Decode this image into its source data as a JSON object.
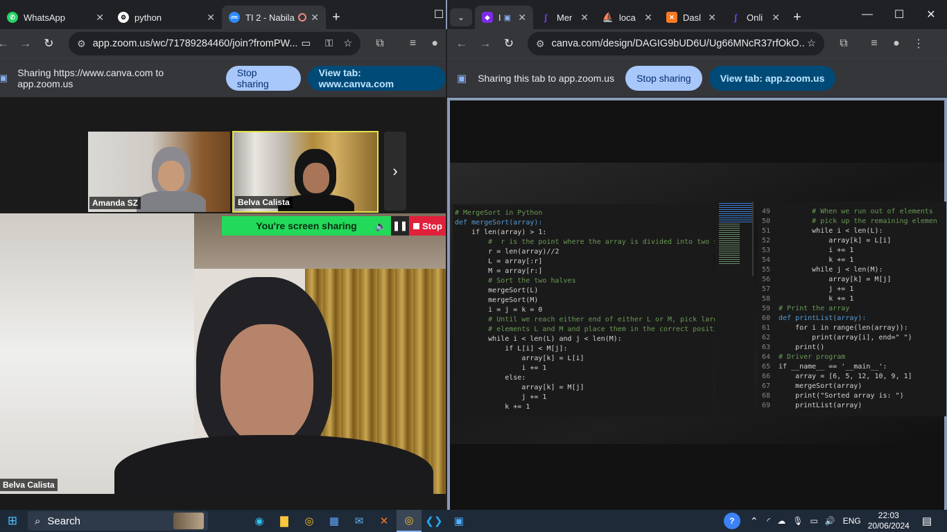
{
  "left_browser": {
    "tabs": [
      {
        "label": "WhatsApp",
        "icon": "whatsapp-icon"
      },
      {
        "label": "python",
        "icon": "chatgpt-icon"
      },
      {
        "label": "TI 2 - Nabila",
        "icon": "zoom-icon"
      }
    ],
    "url": "app.zoom.us/wc/71789284460/join?fromPW...",
    "share_text": "Sharing https://www.canva.com to app.zoom.us",
    "stop_sharing": "Stop sharing",
    "view_tab": "View tab: www.canva.com"
  },
  "right_browser": {
    "tabs": [
      {
        "label": "I",
        "icon": "canva-icon"
      },
      {
        "label": "Mer",
        "icon": "figure-icon"
      },
      {
        "label": "loca",
        "icon": "xampp-icon"
      },
      {
        "label": "Dasl",
        "icon": "xampp-dashboard-icon"
      },
      {
        "label": "Onli",
        "icon": "figure-icon"
      }
    ],
    "url": "canva.com/design/DAGIG9bUD6U/Ug66MNcR37rfOkO...",
    "share_text": "Sharing this tab to app.zoom.us",
    "stop_sharing": "Stop sharing",
    "view_tab": "View tab: app.zoom.us"
  },
  "zoom": {
    "participants": [
      {
        "name": "Amanda SZ"
      },
      {
        "name": "Belva Calista"
      }
    ],
    "main_speaker": "Belva Calista",
    "sharing_banner": "You're screen sharing",
    "stop_label": "Stop"
  },
  "code_left": [
    {
      "text": "# MergeSort in Python",
      "kind": "comment"
    },
    {
      "text": "def mergeSort(array):",
      "kind": "def"
    },
    {
      "text": "    if len(array) > 1:",
      "kind": "code"
    },
    {
      "text": "        #  r is the point where the array is divided into two sub",
      "kind": "comment"
    },
    {
      "text": "        r = len(array)//2",
      "kind": "code"
    },
    {
      "text": "        L = array[:r]",
      "kind": "code"
    },
    {
      "text": "        M = array[r:]",
      "kind": "code"
    },
    {
      "text": "        # Sort the two halves",
      "kind": "comment"
    },
    {
      "text": "        mergeSort(L)",
      "kind": "code"
    },
    {
      "text": "        mergeSort(M)",
      "kind": "code"
    },
    {
      "text": "        i = j = k = 0",
      "kind": "code"
    },
    {
      "text": "        # Until we reach either end of either L or M, pick larger",
      "kind": "comment"
    },
    {
      "text": "        # elements L and M and place them in the correct position",
      "kind": "comment"
    },
    {
      "text": "        while i < len(L) and j < len(M):",
      "kind": "code"
    },
    {
      "text": "            if L[i] < M[j]:",
      "kind": "code"
    },
    {
      "text": "                array[k] = L[i]",
      "kind": "code"
    },
    {
      "text": "                i += 1",
      "kind": "code"
    },
    {
      "text": "            else:",
      "kind": "code"
    },
    {
      "text": "                array[k] = M[j]",
      "kind": "code"
    },
    {
      "text": "                j += 1",
      "kind": "code"
    },
    {
      "text": "            k += 1",
      "kind": "code"
    }
  ],
  "code_right": [
    {
      "n": "49",
      "text": "        # When we run out of elements",
      "kind": "comment"
    },
    {
      "n": "50",
      "text": "        # pick up the remaining elemen",
      "kind": "comment"
    },
    {
      "n": "51",
      "text": "        while i < len(L):",
      "kind": "code"
    },
    {
      "n": "52",
      "text": "            array[k] = L[i]",
      "kind": "code"
    },
    {
      "n": "53",
      "text": "            i += 1",
      "kind": "code"
    },
    {
      "n": "54",
      "text": "            k += 1",
      "kind": "code"
    },
    {
      "n": "55",
      "text": "        while j < len(M):",
      "kind": "code"
    },
    {
      "n": "56",
      "text": "            array[k] = M[j]",
      "kind": "code"
    },
    {
      "n": "57",
      "text": "            j += 1",
      "kind": "code"
    },
    {
      "n": "58",
      "text": "            k += 1",
      "kind": "code"
    },
    {
      "n": "59",
      "text": "# Print the array",
      "kind": "comment"
    },
    {
      "n": "60",
      "text": "def printList(array):",
      "kind": "def"
    },
    {
      "n": "61",
      "text": "    for i in range(len(array)):",
      "kind": "code"
    },
    {
      "n": "62",
      "text": "        print(array[i], end=\" \")",
      "kind": "code"
    },
    {
      "n": "63",
      "text": "    print()",
      "kind": "code"
    },
    {
      "n": "64",
      "text": "# Driver program",
      "kind": "comment"
    },
    {
      "n": "65",
      "text": "if __name__ == '__main__':",
      "kind": "code"
    },
    {
      "n": "66",
      "text": "    array = [6, 5, 12, 10, 9, 1]",
      "kind": "code"
    },
    {
      "n": "67",
      "text": "    mergeSort(array)",
      "kind": "code"
    },
    {
      "n": "68",
      "text": "    print(\"Sorted array is: \")",
      "kind": "code"
    },
    {
      "n": "69",
      "text": "    printList(array)",
      "kind": "code"
    }
  ],
  "taskbar": {
    "search_label": "Search",
    "language": "ENG",
    "time": "22:03",
    "date": "20/06/2024"
  }
}
